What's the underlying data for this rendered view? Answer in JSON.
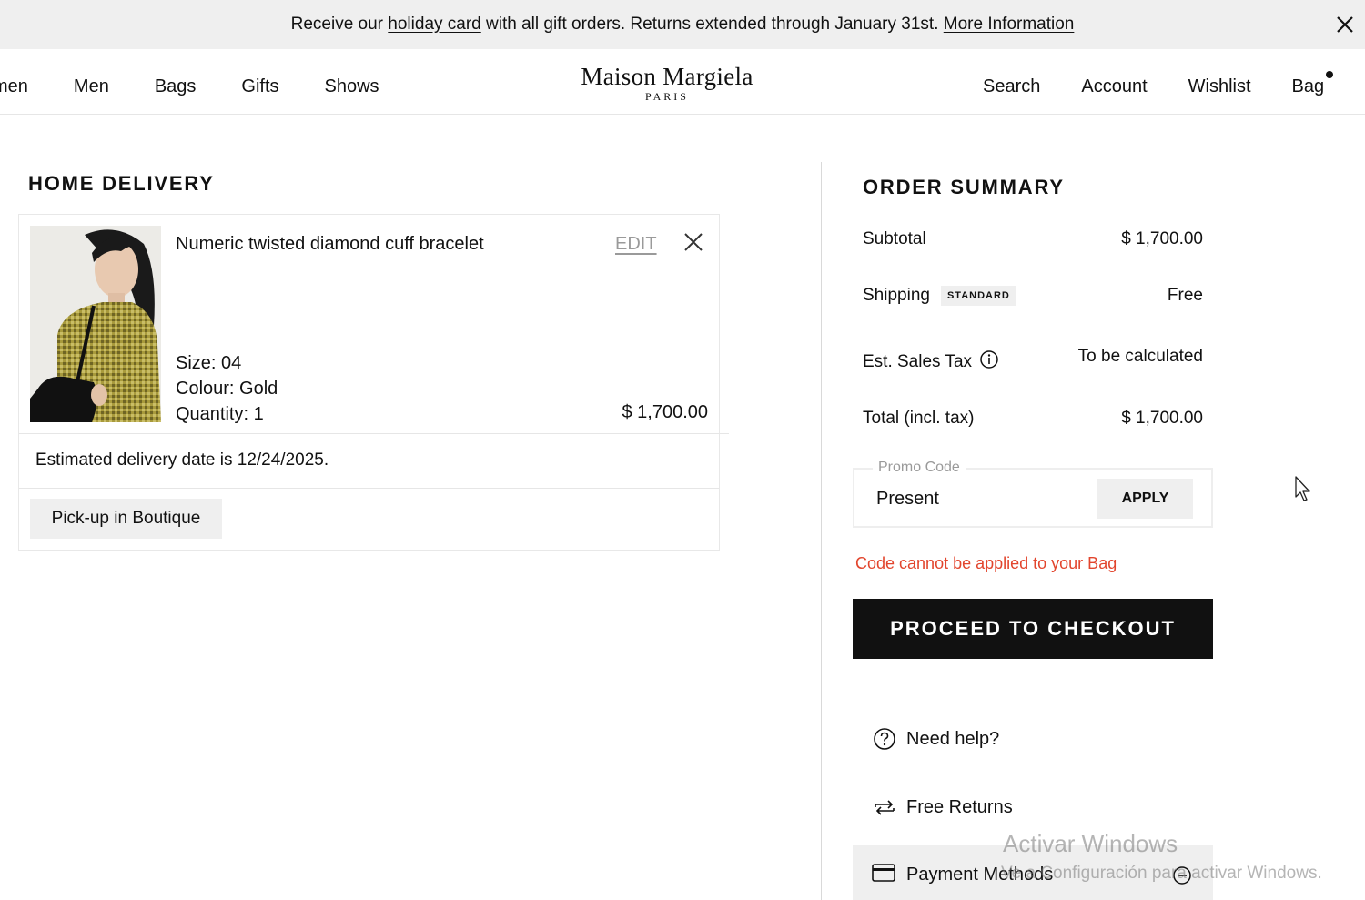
{
  "banner": {
    "text_before": "Receive our ",
    "link1": "holiday card",
    "text_middle": " with all gift orders. Returns extended through January 31st. ",
    "link2": "More Information",
    "close_icon": "close-icon"
  },
  "nav": {
    "left_items": [
      "men",
      "Men",
      "Bags",
      "Gifts",
      "Shows"
    ],
    "right_items": [
      "Search",
      "Account",
      "Wishlist",
      "Bag"
    ]
  },
  "logo": {
    "brand": "Maison Margiela",
    "city": "PARIS"
  },
  "delivery": {
    "title": "HOME DELIVERY",
    "item": {
      "name": "Numeric twisted diamond cuff bracelet",
      "edit_label": "EDIT",
      "size": "Size: 04",
      "colour": "Colour: Gold",
      "quantity": "Quantity: 1",
      "price": "$ 1,700.00"
    },
    "estimated_date": "Estimated delivery date is 12/24/2025.",
    "pickup_label": "Pick-up in Boutique"
  },
  "summary": {
    "title": "ORDER SUMMARY",
    "subtotal_label": "Subtotal",
    "subtotal_value": "$ 1,700.00",
    "shipping_label": "Shipping",
    "shipping_badge": "STANDARD",
    "shipping_value": "Free",
    "tax_label": "Est. Sales Tax",
    "tax_value": "To be calculated",
    "total_label": "Total (incl. tax)",
    "total_value": "$ 1,700.00",
    "promo_legend": "Promo Code",
    "promo_value": "Present",
    "apply_label": "APPLY",
    "promo_error": "Code cannot be applied to your Bag",
    "error_color": "#e2452d",
    "checkout_label": "PROCEED TO CHECKOUT",
    "help_label": "Need help?",
    "returns_label": "Free Returns",
    "payment_label": "Payment Methods"
  },
  "watermark": {
    "line1": "Activar Windows",
    "line2": "Ve a Configuración para activar Windows."
  }
}
